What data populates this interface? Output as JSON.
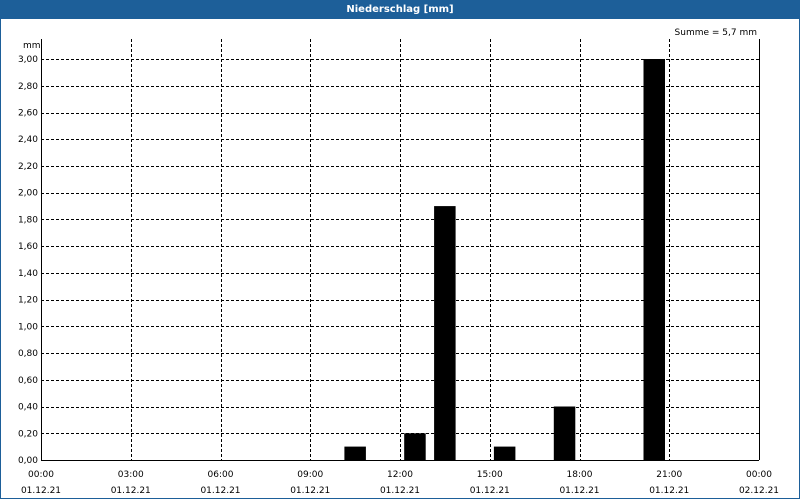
{
  "window": {
    "title": "Niederschlag [mm]"
  },
  "chart_data": {
    "type": "bar",
    "title": "Niederschlag [mm]",
    "ylabel": "mm",
    "xlabel": "",
    "summary": "Summe = 5,7 mm",
    "ylim": [
      0,
      3.15
    ],
    "yticks": [
      0,
      0.2,
      0.4,
      0.6,
      0.8,
      1.0,
      1.2,
      1.4,
      1.6,
      1.8,
      2.0,
      2.2,
      2.4,
      2.6,
      2.8,
      3.0
    ],
    "ytick_labels": [
      "0,00",
      "0,20",
      "0,40",
      "0,60",
      "0,80",
      "1,00",
      "1,20",
      "1,40",
      "1,60",
      "1,80",
      "2,00",
      "2,20",
      "2,40",
      "2,60",
      "2,80",
      "3,00"
    ],
    "x_range_hours": [
      0,
      24
    ],
    "xticks": [
      {
        "time": "00:00",
        "date": "01.12.21"
      },
      {
        "time": "03:00",
        "date": "01.12.21"
      },
      {
        "time": "06:00",
        "date": "01.12.21"
      },
      {
        "time": "09:00",
        "date": "01.12.21"
      },
      {
        "time": "12:00",
        "date": "01.12.21"
      },
      {
        "time": "15:00",
        "date": "01.12.21"
      },
      {
        "time": "18:00",
        "date": "01.12.21"
      },
      {
        "time": "21:00",
        "date": "01.12.21"
      },
      {
        "time": "00:00",
        "date": "02.12.21"
      }
    ],
    "bars": [
      {
        "hour": 11,
        "value": 0.1
      },
      {
        "hour": 13,
        "value": 0.2
      },
      {
        "hour": 14,
        "value": 1.9
      },
      {
        "hour": 16,
        "value": 0.1
      },
      {
        "hour": 18,
        "value": 0.4
      },
      {
        "hour": 21,
        "value": 3.0
      }
    ],
    "grid": true,
    "bar_color": "#000000"
  }
}
